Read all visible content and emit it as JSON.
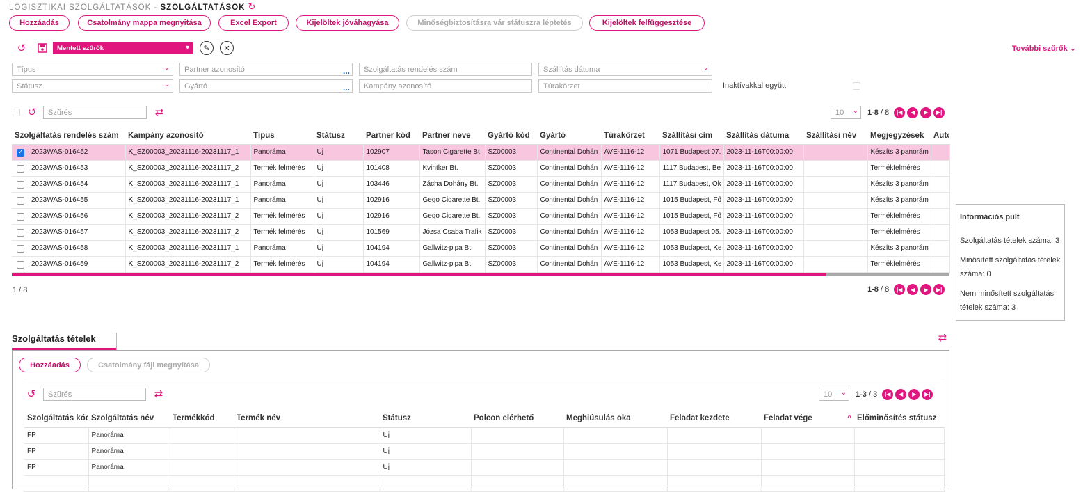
{
  "breadcrumb": {
    "parent": "LOGISZTIKAI SZOLGÁLTATÁSOK - ",
    "current": "SZOLGÁLTATÁSOK"
  },
  "toolbar": {
    "add": "Hozzáadás",
    "open_folder": "Csatolmány mappa megnyitása",
    "excel": "Excel Export",
    "approve": "Kijelöltek jóváhagyása",
    "qa_promote": "Minőségbiztosításra vár státuszra léptetés",
    "suspend": "Kijelöltek felfüggesztése"
  },
  "saved_filters": {
    "label": "Mentett szűrők"
  },
  "more_filters": "További szűrők",
  "filters": {
    "type": "Típus",
    "partner_id": "Partner azonosító",
    "order_no": "Szolgáltatás rendelés szám",
    "ship_date": "Szállítás dátuma",
    "status": "Státusz",
    "manufacturer": "Gyártó",
    "campaign_id": "Kampány azonosító",
    "route": "Túrakörzet",
    "inactive": "Inaktívakkal együtt"
  },
  "grid": {
    "filter_placeholder": "Szűrés",
    "page_size": "10",
    "range": "1-8",
    "total": "8",
    "count_label": "1  /  8",
    "columns": [
      "Szolgáltatás rendelés szám",
      "Kampány azonosító",
      "Típus",
      "Státusz",
      "Partner kód",
      "Partner neve",
      "Gyártó kód",
      "Gyártó",
      "Túrakörzet",
      "Szállítási cím",
      "Szállítás dátuma",
      "Szállítási név",
      "Megjegyzések",
      "Auto"
    ],
    "rows": [
      [
        "2023WAS-016452",
        "K_SZ00003_20231116-20231117_1",
        "Panoráma",
        "Új",
        "102907",
        "Tason Cigarette Bt",
        "SZ00003",
        "Continental Dohán",
        "AVE-1116-12",
        "1071 Budapest 07.",
        "2023-11-16T00:00:00",
        "",
        "Készíts 3 panorám",
        ""
      ],
      [
        "2023WAS-016453",
        "K_SZ00003_20231116-20231117_2",
        "Termék felmérés",
        "Új",
        "101408",
        "Kvintker Bt.",
        "SZ00003",
        "Continental Dohán",
        "AVE-1116-12",
        "1117 Budapest, Be",
        "2023-11-16T00:00:00",
        "",
        "Termékfelmérés",
        ""
      ],
      [
        "2023WAS-016454",
        "K_SZ00003_20231116-20231117_1",
        "Panoráma",
        "Új",
        "103446",
        "Zácha Dohány Bt.",
        "SZ00003",
        "Continental Dohán",
        "AVE-1116-12",
        "1117 Budapest, Ok",
        "2023-11-16T00:00:00",
        "",
        "Készíts 3 panorám",
        ""
      ],
      [
        "2023WAS-016455",
        "K_SZ00003_20231116-20231117_1",
        "Panoráma",
        "Új",
        "102916",
        "Gego Cigarette Bt.",
        "SZ00003",
        "Continental Dohán",
        "AVE-1116-12",
        "1015 Budapest, Fő",
        "2023-11-16T00:00:00",
        "",
        "Készíts 3 panorám",
        ""
      ],
      [
        "2023WAS-016456",
        "K_SZ00003_20231116-20231117_2",
        "Termék felmérés",
        "Új",
        "102916",
        "Gego Cigarette Bt.",
        "SZ00003",
        "Continental Dohán",
        "AVE-1116-12",
        "1015 Budapest, Fő",
        "2023-11-16T00:00:00",
        "",
        "Termékfelmérés",
        ""
      ],
      [
        "2023WAS-016457",
        "K_SZ00003_20231116-20231117_2",
        "Termék felmérés",
        "Új",
        "101569",
        "Józsa Csaba Trafik",
        "SZ00003",
        "Continental Dohán",
        "AVE-1116-12",
        "1053 Budapest 05.",
        "2023-11-16T00:00:00",
        "",
        "Termékfelmérés",
        ""
      ],
      [
        "2023WAS-016458",
        "K_SZ00003_20231116-20231117_1",
        "Panoráma",
        "Új",
        "104194",
        "Gallwitz-pipa Bt.",
        "SZ00003",
        "Continental Dohán",
        "AVE-1116-12",
        "1053 Budapest, Ke",
        "2023-11-16T00:00:00",
        "",
        "Készíts 3 panorám",
        ""
      ],
      [
        "2023WAS-016459",
        "K_SZ00003_20231116-20231117_2",
        "Termék felmérés",
        "Új",
        "104194",
        "Gallwitz-pipa Bt.",
        "SZ00003",
        "Continental Dohán",
        "AVE-1116-12",
        "1053 Budapest, Ke",
        "2023-11-16T00:00:00",
        "",
        "Termékfelmérés",
        ""
      ]
    ]
  },
  "info_panel": {
    "title": "Információs pult",
    "line1": "Szolgáltatás tételek száma: 3",
    "line2": "Minősített szolgáltatás tételek száma: 0",
    "line3": "Nem minősített szolgáltatás tételek száma: 3"
  },
  "subsection": {
    "tab": "Szolgáltatás tételek",
    "add": "Hozzáadás",
    "open_file": "Csatolmány fájl megnyitása",
    "filter_placeholder": "Szűrés",
    "page_size": "10",
    "range": "1-3",
    "total": "3",
    "columns": [
      "Szolgáltatás kód",
      "Szolgáltatás név",
      "Termékkód",
      "Termék név",
      "Státusz",
      "Polcon elérhető",
      "Meghiúsulás oka",
      "Feladat kezdete",
      "Feladat vége",
      "Előminősítés státusz"
    ],
    "sort_indicator": "^",
    "rows": [
      [
        "FP",
        "Panoráma",
        "",
        "",
        "Új",
        "",
        "",
        "",
        "",
        ""
      ],
      [
        "FP",
        "Panoráma",
        "",
        "",
        "Új",
        "",
        "",
        "",
        "",
        ""
      ],
      [
        "FP",
        "Panoráma",
        "",
        "",
        "Új",
        "",
        "",
        "",
        "",
        ""
      ],
      [
        "",
        "",
        "",
        "",
        "",
        "",
        "",
        "",
        "",
        ""
      ]
    ]
  },
  "colors": {
    "accent": "#e0167e",
    "selected_row": "#f8c6df"
  }
}
